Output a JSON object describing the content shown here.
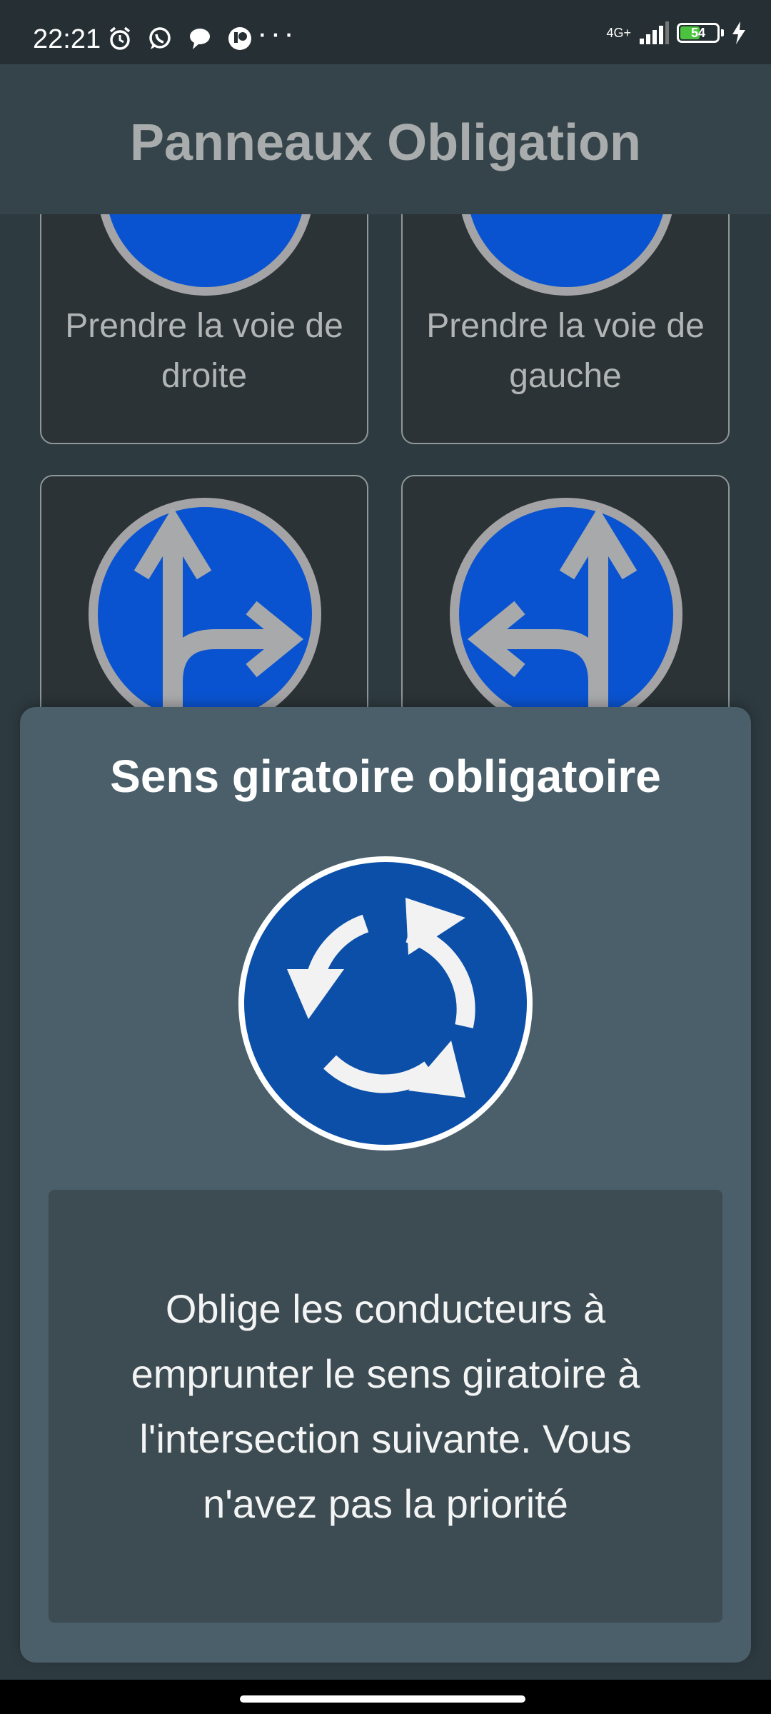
{
  "status_bar": {
    "time": "22:21",
    "network": "4G+",
    "battery": "54",
    "icons": [
      "alarm-icon",
      "whatsapp-icon",
      "chat-bubble-icon",
      "app-notification-icon",
      "more-dots-icon",
      "signal-icon",
      "battery-icon",
      "charging-icon"
    ],
    "dots": "···"
  },
  "header": {
    "title": "Panneaux Obligation"
  },
  "cards": [
    {
      "label": "Prendre la voie de droite",
      "icon": "keep-right-sign-icon"
    },
    {
      "label": "Prendre la voie de gauche",
      "icon": "keep-left-sign-icon"
    },
    {
      "label": "",
      "icon": "straight-or-right-sign-icon"
    },
    {
      "label": "",
      "icon": "straight-or-left-sign-icon"
    }
  ],
  "dialog": {
    "title": "Sens giratoire obligatoire",
    "icon": "roundabout-sign-icon",
    "description": "Oblige les conducteurs à emprunter le sens giratoire à l'intersection suivante. Vous n'avez pas la priorité"
  },
  "colors": {
    "sign_blue": "#0b4fa8",
    "sign_blue_bright": "#0a53d0",
    "sign_rim": "#a4a4a6",
    "dialog_bg": "#4a5f6a",
    "battery_fill": "#4cc33e"
  }
}
